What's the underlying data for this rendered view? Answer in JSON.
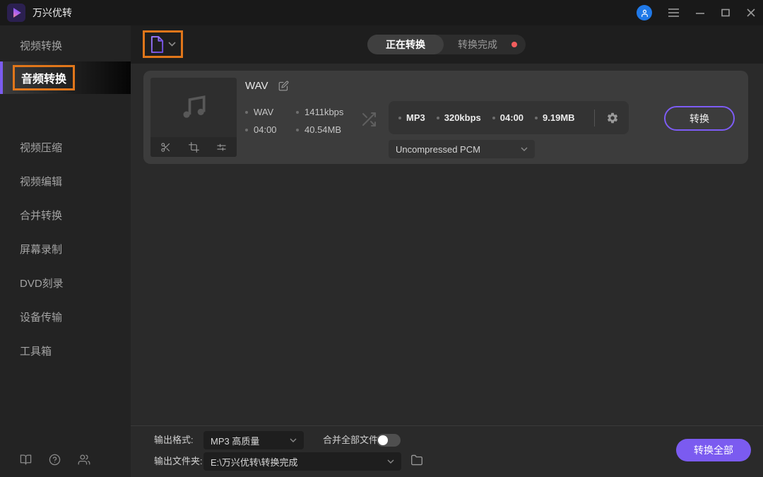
{
  "app": {
    "title": "万兴优转"
  },
  "titlebar": {
    "controls": [
      "user-avatar",
      "menu",
      "minimize",
      "maximize",
      "close"
    ]
  },
  "sidebar": {
    "items": [
      {
        "label": "视频转换",
        "active": false
      },
      {
        "label": "音频转换",
        "active": true
      },
      {
        "label": "视频压缩",
        "active": false
      },
      {
        "label": "视频编辑",
        "active": false
      },
      {
        "label": "合并转换",
        "active": false
      },
      {
        "label": "屏幕录制",
        "active": false
      },
      {
        "label": "DVD刻录",
        "active": false
      },
      {
        "label": "设备传输",
        "active": false
      },
      {
        "label": "工具箱",
        "active": false
      }
    ]
  },
  "header": {
    "tabs": [
      {
        "label": "正在转换",
        "active": true
      },
      {
        "label": "转换完成",
        "active": false,
        "has_red_badge": true
      }
    ]
  },
  "task": {
    "title": "WAV",
    "source": {
      "format": "WAV",
      "bitrate": "1411kbps",
      "duration": "04:00",
      "size": "40.54MB"
    },
    "target": {
      "format": "MP3",
      "bitrate": "320kbps",
      "duration": "04:00",
      "size": "9.19MB"
    },
    "codec": "Uncompressed PCM",
    "convert_label": "转换"
  },
  "footer": {
    "output_format_label": "输出格式:",
    "output_format_value": "MP3 高质量",
    "merge_label": "合并全部文件",
    "merge_enabled": false,
    "output_folder_label": "输出文件夹:",
    "output_folder_value": "E:\\万兴优转\\转换完成",
    "convert_all_label": "转换全部"
  },
  "colors": {
    "accent_purple": "#7c5cf0",
    "annotation_orange": "#e0761a",
    "avatar_blue": "#2079e8",
    "badge_red": "#f25d5d",
    "card_bg": "#3c3c3c",
    "main_bg": "#2a2a2a",
    "titlebar_bg": "#191919"
  },
  "icons": {
    "add-file-icon": "document-with-plus",
    "chevron-down-icon": "⌄",
    "user-avatar-icon": "person-outline",
    "hamburger-menu-icon": "≡",
    "minimize-icon": "—",
    "maximize-icon": "□",
    "close-icon": "✕",
    "music-note-icon": "♫",
    "scissors-icon": "✂",
    "crop-icon": "crop-frame",
    "sliders-icon": "adjust-sliders",
    "edit-icon": "pencil-square",
    "shuffle-icon": "crossed-arrows",
    "gear-icon": "⚙",
    "book-icon": "open-book",
    "help-icon": "question-circle",
    "users-icon": "two-people",
    "folder-icon": "folder"
  }
}
